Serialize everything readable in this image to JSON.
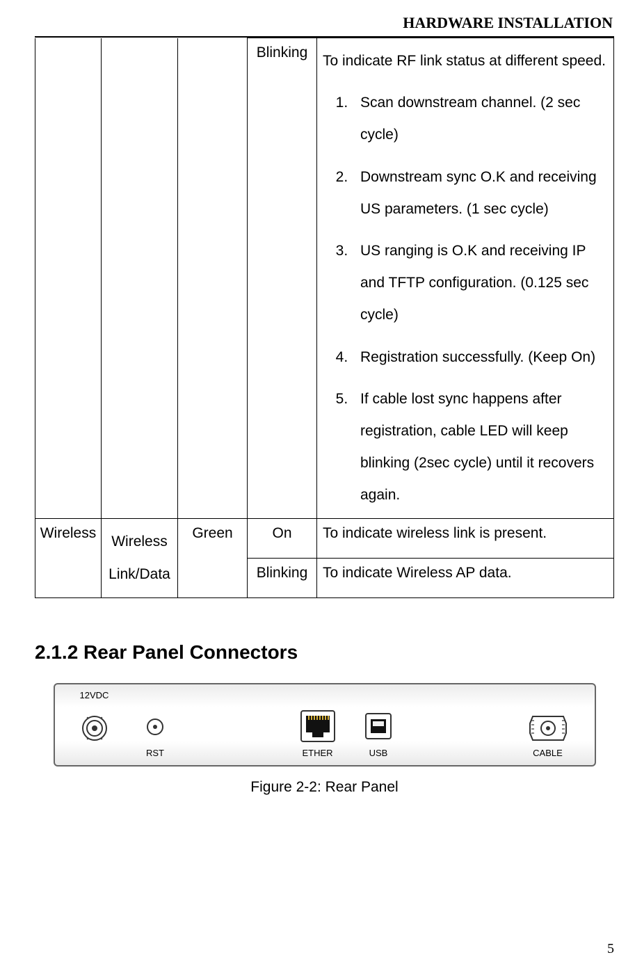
{
  "header": {
    "title": "HARDWARE INSTALLATION"
  },
  "table": {
    "row_blinking": {
      "status": "Blinking",
      "intro": "To indicate RF link status at different speed.",
      "steps": [
        "Scan downstream channel. (2 sec cycle)",
        "Downstream sync O.K and receiving US parameters. (1 sec cycle)",
        "US ranging is O.K and receiving IP and TFTP configuration. (0.125 sec cycle)",
        "Registration successfully. (Keep On)",
        "If cable lost sync happens after registration, cable LED will keep blinking (2sec cycle) until it recovers again."
      ]
    },
    "row_wireless_on": {
      "c1": "Wireless",
      "c2_line1": "Wireless",
      "c2_line2": "Link/Data",
      "c3": "Green",
      "c4": "On",
      "c5": "To indicate wireless link is present."
    },
    "row_wireless_blinking": {
      "c4": "Blinking",
      "c5": "To indicate Wireless AP data."
    }
  },
  "section_heading": "2.1.2 Rear Panel Connectors",
  "rear_panel": {
    "power_label": "12VDC",
    "rst_label": "RST",
    "ether_label": "ETHER",
    "usb_label": "USB",
    "cable_label": "CABLE"
  },
  "figure_caption": "Figure 2-2: Rear Panel",
  "page_number": "5"
}
